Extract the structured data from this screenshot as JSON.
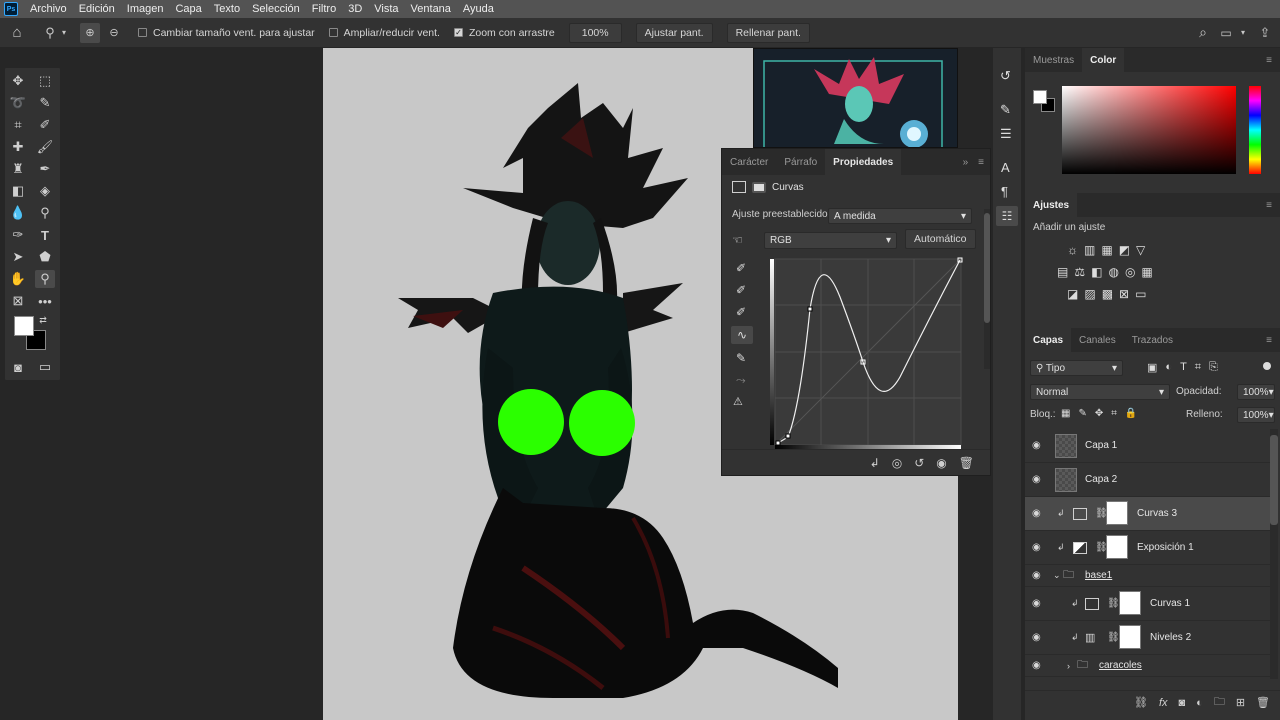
{
  "menu": {
    "logo": "Ps",
    "items": [
      "Archivo",
      "Edición",
      "Imagen",
      "Capa",
      "Texto",
      "Selección",
      "Filtro",
      "3D",
      "Vista",
      "Ventana",
      "Ayuda"
    ]
  },
  "options": {
    "resize_windows": "Cambiar tamaño vent. para ajustar",
    "zoom_all": "Ampliar/reducir vent.",
    "scrubby": "Zoom con arrastre",
    "zoom_value": "100%",
    "fit_screen": "Ajustar pant.",
    "fill_screen": "Rellenar pant."
  },
  "properties": {
    "tabs": [
      "Carácter",
      "Párrafo",
      "Propiedades"
    ],
    "type_label": "Curvas",
    "preset_label": "Ajuste preestablecido:",
    "preset_value": "A medida",
    "channel": "RGB",
    "auto_label": "Automático"
  },
  "swatches": {
    "tabs": [
      "Muestras",
      "Color"
    ]
  },
  "adjustments": {
    "title": "Ajustes",
    "add_label": "Añadir un ajuste"
  },
  "layers": {
    "tabs": [
      "Capas",
      "Canales",
      "Trazados"
    ],
    "filter": "Tipo",
    "blend_mode": "Normal",
    "opacity_label": "Opacidad:",
    "opacity_value": "100%",
    "lock_label": "Bloq.:",
    "fill_label": "Relleno:",
    "fill_value": "100%",
    "items": [
      {
        "name": "Capa 1"
      },
      {
        "name": "Capa 2"
      },
      {
        "name": "Curvas 3"
      },
      {
        "name": "Exposición 1"
      },
      {
        "name": "base1"
      },
      {
        "name": "Curvas 1"
      },
      {
        "name": "Niveles 2"
      },
      {
        "name": "caracoles"
      }
    ]
  },
  "colors": {
    "accent": "#31a8ff",
    "green": "#2bff00",
    "canvas_bg": "#c8c8c8"
  }
}
